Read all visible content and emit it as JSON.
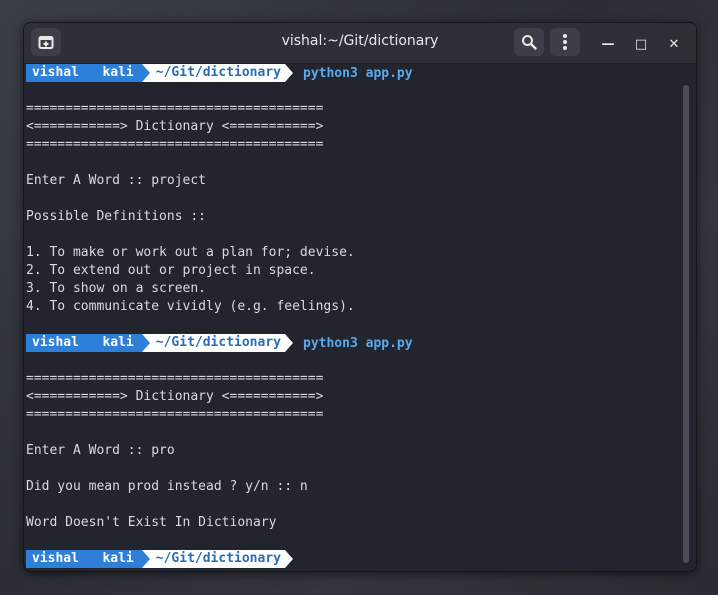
{
  "window": {
    "title": "vishal:~/Git/dictionary",
    "new_tab_icon": "new-tab-icon",
    "search_icon": "search-icon",
    "menu_icon": "kebab-menu-icon",
    "minimize_glyph": "—",
    "maximize_glyph": "□",
    "close_glyph": "✕"
  },
  "prompt": {
    "user": "vishal",
    "host": "kali",
    "path": "~/Git/dictionary"
  },
  "terminal": {
    "command1": "python3 app.py",
    "command2": "python3 app.py",
    "banner_top": "======================================",
    "banner_title": "<===========> Dictionary <===========>",
    "banner_bottom": "======================================",
    "run1": {
      "enter_word": "Enter A Word :: project",
      "possible": "Possible Definitions ::",
      "definitions": [
        "1. To make or work out a plan for; devise.",
        "2. To extend out or project in space.",
        "3. To show on a screen.",
        "4. To communicate vividly (e.g. feelings)."
      ]
    },
    "run2": {
      "enter_word": "Enter A Word :: pro",
      "did_you_mean": "Did you mean prod instead ? y/n :: n",
      "result": "Word Doesn't Exist In Dictionary"
    }
  },
  "colors": {
    "prompt_user_bg": "#2e7fd8",
    "prompt_path_fg": "#2a6db5",
    "command_fg": "#5aa9ec",
    "terminal_bg": "#23252e",
    "text": "#d8dae0"
  }
}
